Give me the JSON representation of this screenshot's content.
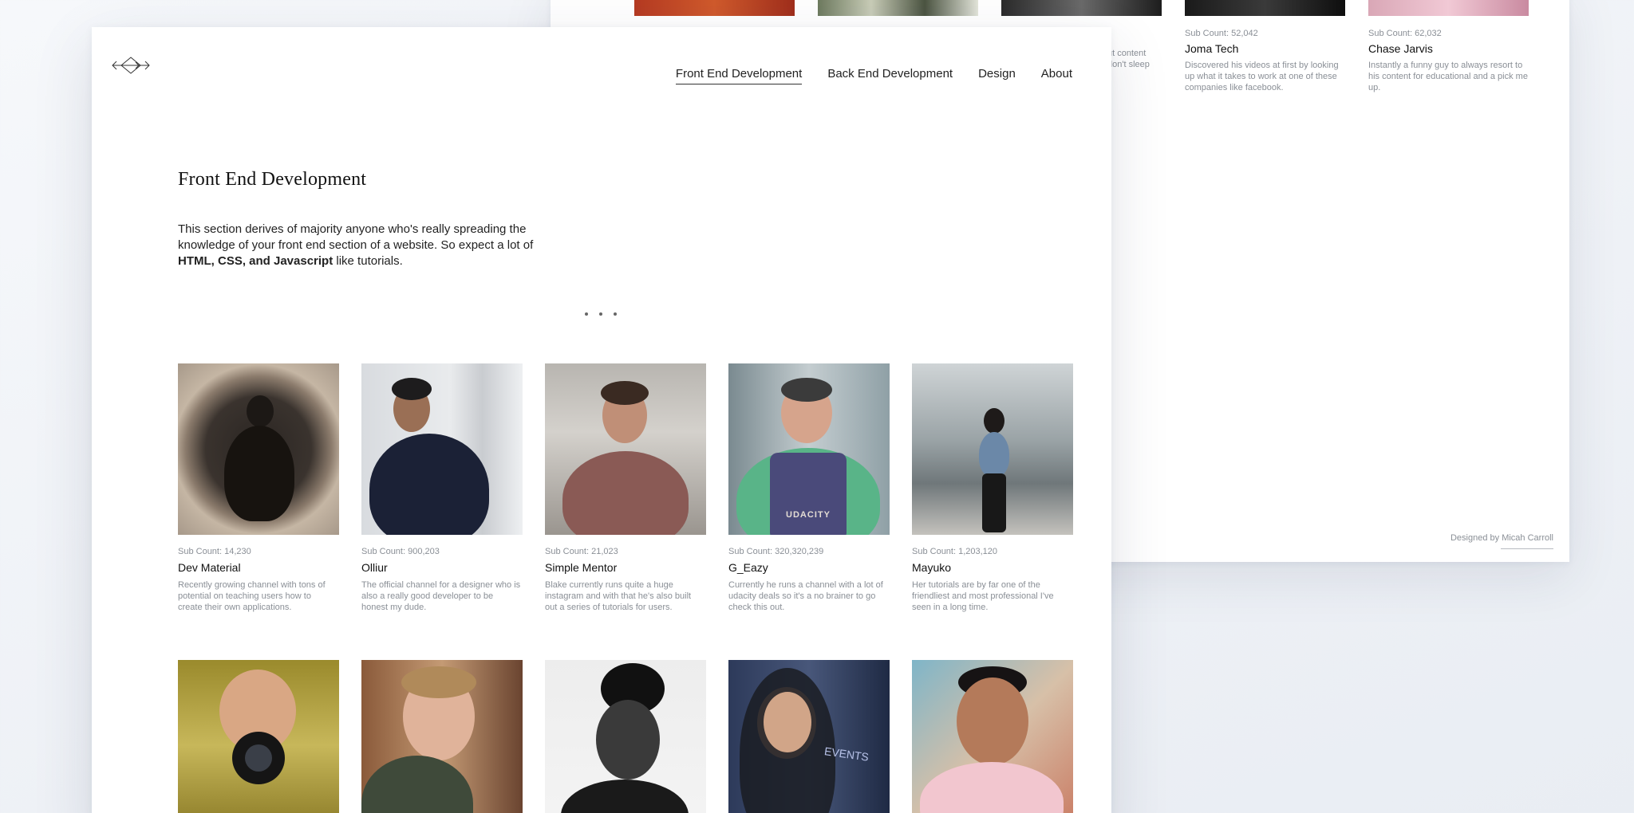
{
  "back_card": {
    "partial_desc": [
      "ut content",
      "don't sleep"
    ],
    "items": [
      {
        "sub": "Sub Count: 52,042",
        "name": "Joma Tech",
        "desc": "Discovered his videos at first by looking up what it takes to work at one of these companies like facebook."
      },
      {
        "sub": "Sub Count: 62,032",
        "name": "Chase Jarvis",
        "desc": "Instantly a funny guy to always resort to his content for educational and a pick me up."
      }
    ],
    "credit_prefix": "Designed by ",
    "credit_name": "Micah Carroll"
  },
  "nav": {
    "items": [
      "Front End Development",
      "Back End Development",
      "Design",
      "About"
    ],
    "active": "Front End Development"
  },
  "page": {
    "title": "Front End Development",
    "intro_before": "This section derives of majority anyone who's really spreading the knowledge of your front end section of a website. So expect a lot of ",
    "intro_strong": "HTML, CSS, and Javascript",
    "intro_after": " like tutorials."
  },
  "channels": [
    {
      "sub": "Sub Count: 14,230",
      "name": "Dev Material",
      "desc": "Recently growing channel with tons of potential on teaching users how to create their own applications."
    },
    {
      "sub": "Sub Count: 900,203",
      "name": "Olliur",
      "desc": "The official channel for a designer who is also a really good developer to be honest my dude."
    },
    {
      "sub": "Sub Count: 21,023",
      "name": "Simple Mentor",
      "desc": "Blake currently runs quite a huge instagram and with that he's also built out a series of tutorials for users."
    },
    {
      "sub": "Sub Count: 320,320,239",
      "name": "G_Eazy",
      "desc": "Currently he runs a channel with a lot of udacity deals so it's a no brainer to go check this out."
    },
    {
      "sub": "Sub Count: 1,203,120",
      "name": "Mayuko",
      "desc": "Her tutorials are by far one of the friendliest and most professional I've seen in a long time."
    }
  ],
  "photo_text": {
    "udacity_shirt": "UDACITY",
    "events_sign": "EVENTS"
  },
  "icons": {
    "logo": "diamond-arrow-logo-icon"
  }
}
